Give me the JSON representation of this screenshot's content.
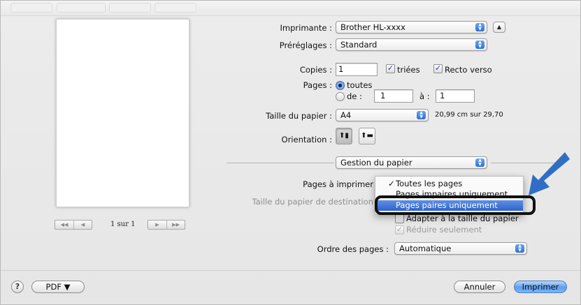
{
  "printer": {
    "label": "Imprimante :",
    "value": "Brother HL-xxxx"
  },
  "presets": {
    "label": "Préréglages :",
    "value": "Standard"
  },
  "copies": {
    "label": "Copies :",
    "value": "1",
    "collated_label": "triées",
    "collated": true,
    "duplex_label": "Recto verso",
    "duplex": true
  },
  "pages": {
    "label": "Pages :",
    "all_label": "toutes",
    "from_label": "de :",
    "from_value": "1",
    "to_label": "à :",
    "to_value": "1",
    "selected": "all"
  },
  "paper_size": {
    "label": "Taille du papier :",
    "value": "A4",
    "dimensions": "20,99 cm sur 29,70"
  },
  "orientation": {
    "label": "Orientation :",
    "selected": "portrait"
  },
  "panel": {
    "value": "Gestion du papier"
  },
  "pages_to_print": {
    "label": "Pages à imprimer",
    "menu_items": [
      {
        "label": "Toutes les pages",
        "checked": true
      },
      {
        "label": "Pages impaires uniquement",
        "checked": false
      },
      {
        "label": "Pages paires uniquement",
        "checked": false
      }
    ],
    "highlighted": "Pages paires uniquement"
  },
  "destination_paper": {
    "label": "Taille du papier de destination"
  },
  "scale": {
    "fit_label": "Adapter à la taille du papier",
    "fit": false,
    "reduce_label": "Réduire seulement",
    "reduce": true
  },
  "page_order": {
    "label": "Ordre des pages :",
    "value": "Automatique"
  },
  "preview": {
    "page_text": "1 sur 1"
  },
  "footer": {
    "help": "?",
    "pdf_label": "PDF ▼",
    "cancel_label": "Annuler",
    "print_label": "Imprimer"
  },
  "colors": {
    "accent": "#2f6fd3",
    "arrow": "#2f6ec4"
  }
}
